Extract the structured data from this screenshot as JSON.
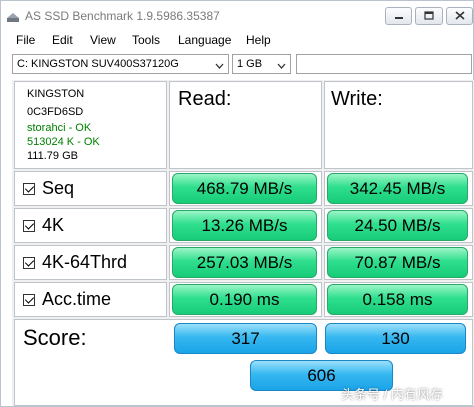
{
  "window": {
    "title": "AS SSD Benchmark 1.9.5986.35387",
    "controls": {
      "minimize": "minimize",
      "maximize": "maximize",
      "close": "close"
    }
  },
  "menu": [
    "File",
    "Edit",
    "View",
    "Tools",
    "Language",
    "Help"
  ],
  "toolbar": {
    "drive_selected": "C: KINGSTON SUV400S37120G",
    "size_selected": "1 GB",
    "text_value": ""
  },
  "drive_info": {
    "model": "KINGSTON",
    "firmware": "0C3FD6SD",
    "driver": "storahci - OK",
    "alignment": "513024 K - OK",
    "capacity": "111.79 GB"
  },
  "headers": {
    "read": "Read:",
    "write": "Write:"
  },
  "tests": [
    {
      "name": "Seq",
      "checked": true,
      "read": "468.79 MB/s",
      "write": "342.45 MB/s"
    },
    {
      "name": "4K",
      "checked": true,
      "read": "13.26 MB/s",
      "write": "24.50 MB/s"
    },
    {
      "name": "4K-64Thrd",
      "checked": true,
      "read": "257.03 MB/s",
      "write": "70.87 MB/s"
    },
    {
      "name": "Acc.time",
      "checked": true,
      "read": "0.190 ms",
      "write": "0.158 ms"
    }
  ],
  "score": {
    "label": "Score:",
    "read": "317",
    "write": "130",
    "total": "606"
  },
  "watermark": "头条号 / 内有风存",
  "colors": {
    "result_green": "#2fdf8e",
    "score_blue": "#36b8f0",
    "info_green": "#008000"
  }
}
